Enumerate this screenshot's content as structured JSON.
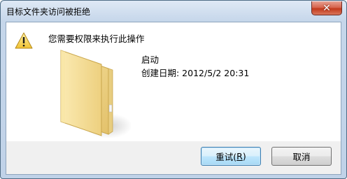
{
  "window": {
    "title": "目标文件夹访问被拒绝",
    "close_symbol": "✕"
  },
  "message": "您需要权限来执行此操作",
  "item": {
    "name": "启动",
    "created": "创建日期: 2012/5/2 20:31"
  },
  "buttons": {
    "retry": {
      "label_before": "重试(",
      "mnemonic": "R",
      "label_after": ")"
    },
    "cancel": {
      "label": "取消"
    }
  },
  "icons": {
    "warning": "warning-icon",
    "folder": "folder-icon",
    "close": "close-icon"
  },
  "colors": {
    "close_red": "#c23a1c",
    "folder_yellow": "#f3d98a",
    "default_button_border": "#3c7fb1"
  }
}
